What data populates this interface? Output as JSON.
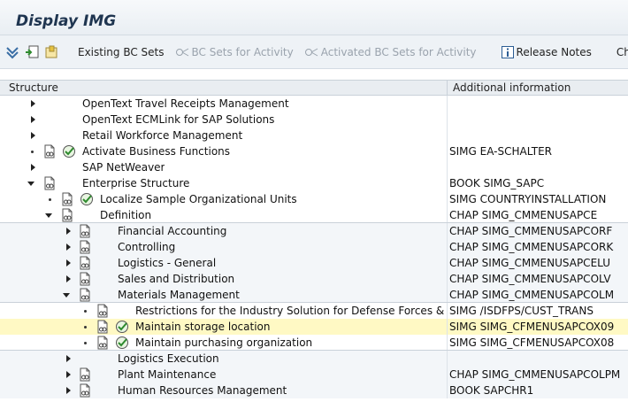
{
  "window": {
    "title": "Display IMG"
  },
  "toolbar": {
    "existing_bc_sets": "Existing BC Sets",
    "bc_sets_for_activity": "BC Sets for Activity",
    "activated_bc_sets": "Activated BC Sets for Activity",
    "release_notes": "Release Notes",
    "change": "Change"
  },
  "header": {
    "structure": "Structure",
    "additional_information": "Additional information"
  },
  "tree": {
    "rows": [
      {
        "label": "OpenText Travel Receipts Management",
        "info": ""
      },
      {
        "label": "OpenText ECMLink for SAP Solutions",
        "info": ""
      },
      {
        "label": "Retail Workforce Management",
        "info": ""
      },
      {
        "label": "Activate Business Functions",
        "info": "SIMG EA-SCHALTER"
      },
      {
        "label": "SAP NetWeaver",
        "info": ""
      },
      {
        "label": "Enterprise Structure",
        "info": "BOOK SIMG_SAPC"
      },
      {
        "label": "Localize Sample Organizational Units",
        "info": "SIMG COUNTRYINSTALLATION"
      },
      {
        "label": "Definition",
        "info": "CHAP SIMG_CMMENUSAPCE"
      },
      {
        "label": "Financial Accounting",
        "info": "CHAP SIMG_CMMENUSAPCORF"
      },
      {
        "label": "Controlling",
        "info": "CHAP SIMG_CMMENUSAPCORK"
      },
      {
        "label": "Logistics - General",
        "info": "CHAP SIMG_CMMENUSAPCELU"
      },
      {
        "label": "Sales and Distribution",
        "info": "CHAP SIMG_CMMENUSAPCOLV"
      },
      {
        "label": "Materials Management",
        "info": "CHAP SIMG_CMMENUSAPCOLM"
      },
      {
        "label": "Restrictions for the Industry Solution for Defense Forces & Public Security",
        "info": "SIMG /ISDFPS/CUST_TRANS"
      },
      {
        "label": "Maintain storage location",
        "info": "SIMG SIMG_CFMENUSAPCOX09"
      },
      {
        "label": "Maintain purchasing organization",
        "info": "SIMG SIMG_CFMENUSAPCOX08"
      },
      {
        "label": "Logistics Execution",
        "info": ""
      },
      {
        "label": "Plant Maintenance",
        "info": "CHAP SIMG_CMMENUSAPCOLPM"
      },
      {
        "label": "Human Resources Management",
        "info": "BOOK SAPCHR1"
      }
    ]
  }
}
